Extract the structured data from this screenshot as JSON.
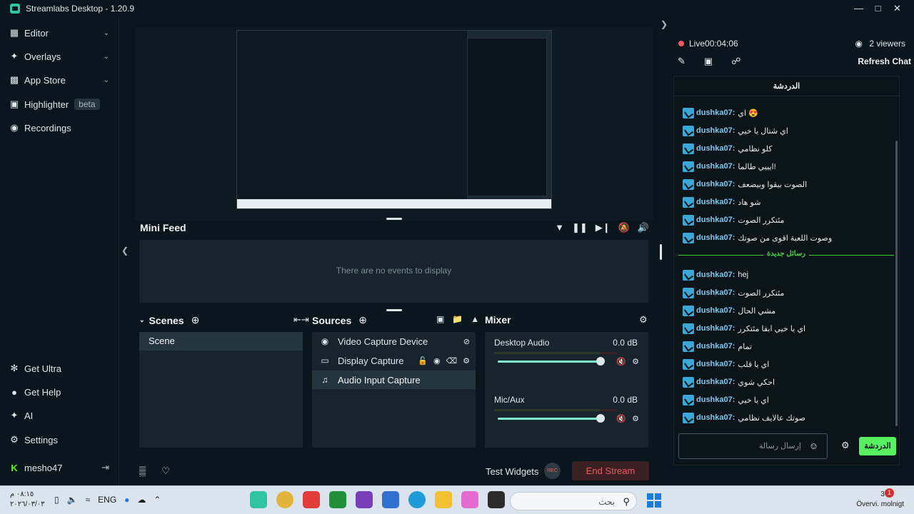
{
  "window": {
    "title": "Streamlabs Desktop - 1.20.9"
  },
  "sidebar": {
    "items": [
      {
        "label": "Editor",
        "icon": "editor-icon"
      },
      {
        "label": "Overlays",
        "icon": "overlays-icon"
      },
      {
        "label": "App Store",
        "icon": "store-icon"
      },
      {
        "label": "Highlighter",
        "icon": "highlighter-icon",
        "badge": "beta"
      },
      {
        "label": "Recordings",
        "icon": "recordings-icon"
      }
    ],
    "bottom": [
      {
        "label": "Get Ultra",
        "icon": "ultra-icon"
      },
      {
        "label": "Get Help",
        "icon": "help-icon"
      },
      {
        "label": "AI",
        "icon": "ai-icon"
      },
      {
        "label": "Settings",
        "icon": "gear-icon"
      }
    ],
    "user": "mesho47"
  },
  "minifeed": {
    "title": "Mini Feed",
    "empty": "There are no events to display"
  },
  "scenes": {
    "title": "Scenes",
    "items": [
      "Scene"
    ]
  },
  "sources": {
    "title": "Sources",
    "items": [
      "Video Capture Device",
      "Display Capture",
      "Audio Input Capture"
    ]
  },
  "mixer": {
    "title": "Mixer",
    "channels": [
      {
        "name": "Desktop Audio",
        "db": "0.0 dB",
        "level": 1.0
      },
      {
        "name": "Mic/Aux",
        "db": "0.0 dB",
        "level": 1.0
      }
    ]
  },
  "footer": {
    "test_widgets": "Test Widgets",
    "rec": "REC",
    "end_stream": "End Stream"
  },
  "chat": {
    "live": "Live",
    "time": "00:04:06",
    "viewers": "2 viewers",
    "refresh": "Refresh Chat",
    "header": "الدردشة",
    "messages": [
      {
        "user": "dushka07:",
        "text": "اي 😍"
      },
      {
        "user": "dushka07:",
        "text": "اي شتال يا خيي"
      },
      {
        "user": "dushka07:",
        "text": "كلو نظامي"
      },
      {
        "user": "dushka07:",
        "text": "ايييي طالما!"
      },
      {
        "user": "dushka07:",
        "text": "الصوت بيقوا وبيضعف"
      },
      {
        "user": "dushka07:",
        "text": "شو هاد"
      },
      {
        "user": "dushka07:",
        "text": "مئتكرر الصوت"
      },
      {
        "user": "dushka07:",
        "text": "وصوت اللعبة اقوى من صوتك"
      }
    ],
    "new_label": "رسائل جديدة",
    "new_messages": [
      {
        "user": "dushka07:",
        "text": "hej"
      },
      {
        "user": "dushka07:",
        "text": "مئتكرر الصوت"
      },
      {
        "user": "dushka07:",
        "text": "مشي الحال"
      },
      {
        "user": "dushka07:",
        "text": "اي يا خيي ابقا مئتكرر"
      },
      {
        "user": "dushka07:",
        "text": "تمام"
      },
      {
        "user": "dushka07:",
        "text": "اي يا قلب"
      },
      {
        "user": "dushka07:",
        "text": "احكي شوي"
      },
      {
        "user": "dushka07:",
        "text": "اي يا خيي"
      },
      {
        "user": "dushka07:",
        "text": "صوتك عالايف نظامي"
      }
    ],
    "input_placeholder": "إرسال رسالة",
    "send": "الدردشة"
  },
  "taskbar": {
    "time": "٠٨:١٥ م",
    "date": "٢٠٢٦/٠٣/٠٣",
    "lang": "ENG",
    "search_placeholder": "بحث",
    "temp": "3°C",
    "weather": "Övervi. molnigt",
    "notif": "1"
  },
  "colors": {
    "accent": "#80f5d2",
    "live": "#f25a5a",
    "chat_user": "#7ec8ef",
    "send": "#56f060"
  }
}
